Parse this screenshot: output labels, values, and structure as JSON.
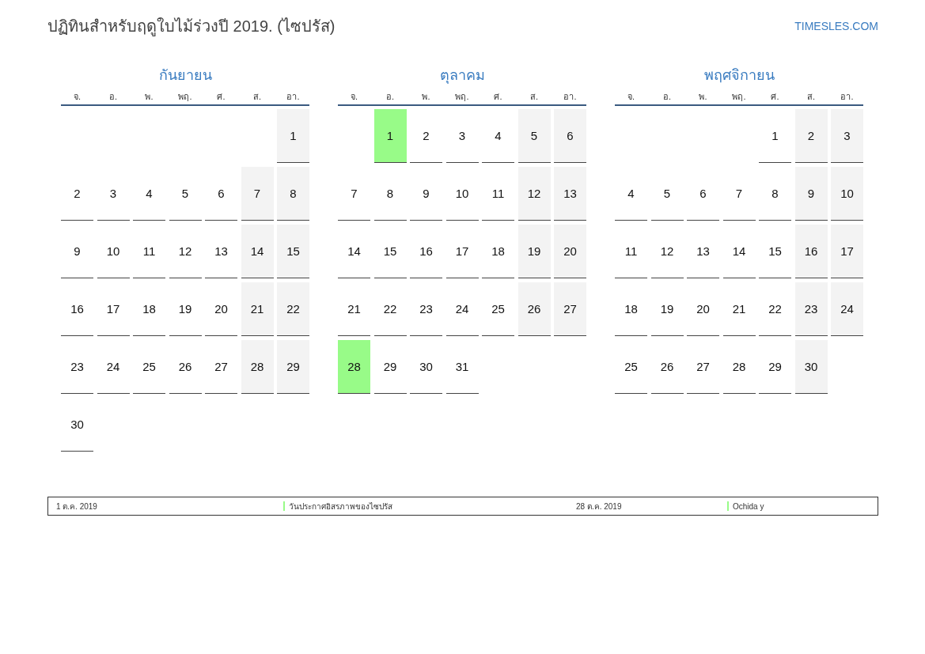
{
  "title": "ปฏิทินสำหรับฤดูใบไม้ร่วงปี 2019. (ไซปรัส)",
  "site": "TIMESLES.COM",
  "months": [
    {
      "name": "กันยายน",
      "weekdays": [
        "จ.",
        "อ.",
        "พ.",
        "พฤ.",
        "ศ.",
        "ส.",
        "อา."
      ],
      "weeks": [
        [
          {
            "kind": "empty"
          },
          {
            "kind": "empty"
          },
          {
            "kind": "empty"
          },
          {
            "kind": "empty"
          },
          {
            "kind": "empty"
          },
          {
            "kind": "empty"
          },
          {
            "kind": "day",
            "day": "1",
            "weekend": true,
            "holiday": false
          }
        ],
        [
          {
            "kind": "day",
            "day": "2",
            "weekend": false,
            "holiday": false
          },
          {
            "kind": "day",
            "day": "3",
            "weekend": false,
            "holiday": false
          },
          {
            "kind": "day",
            "day": "4",
            "weekend": false,
            "holiday": false
          },
          {
            "kind": "day",
            "day": "5",
            "weekend": false,
            "holiday": false
          },
          {
            "kind": "day",
            "day": "6",
            "weekend": false,
            "holiday": false
          },
          {
            "kind": "day",
            "day": "7",
            "weekend": true,
            "holiday": false
          },
          {
            "kind": "day",
            "day": "8",
            "weekend": true,
            "holiday": false
          }
        ],
        [
          {
            "kind": "day",
            "day": "9",
            "weekend": false,
            "holiday": false
          },
          {
            "kind": "day",
            "day": "10",
            "weekend": false,
            "holiday": false
          },
          {
            "kind": "day",
            "day": "11",
            "weekend": false,
            "holiday": false
          },
          {
            "kind": "day",
            "day": "12",
            "weekend": false,
            "holiday": false
          },
          {
            "kind": "day",
            "day": "13",
            "weekend": false,
            "holiday": false
          },
          {
            "kind": "day",
            "day": "14",
            "weekend": true,
            "holiday": false
          },
          {
            "kind": "day",
            "day": "15",
            "weekend": true,
            "holiday": false
          }
        ],
        [
          {
            "kind": "day",
            "day": "16",
            "weekend": false,
            "holiday": false
          },
          {
            "kind": "day",
            "day": "17",
            "weekend": false,
            "holiday": false
          },
          {
            "kind": "day",
            "day": "18",
            "weekend": false,
            "holiday": false
          },
          {
            "kind": "day",
            "day": "19",
            "weekend": false,
            "holiday": false
          },
          {
            "kind": "day",
            "day": "20",
            "weekend": false,
            "holiday": false
          },
          {
            "kind": "day",
            "day": "21",
            "weekend": true,
            "holiday": false
          },
          {
            "kind": "day",
            "day": "22",
            "weekend": true,
            "holiday": false
          }
        ],
        [
          {
            "kind": "day",
            "day": "23",
            "weekend": false,
            "holiday": false
          },
          {
            "kind": "day",
            "day": "24",
            "weekend": false,
            "holiday": false
          },
          {
            "kind": "day",
            "day": "25",
            "weekend": false,
            "holiday": false
          },
          {
            "kind": "day",
            "day": "26",
            "weekend": false,
            "holiday": false
          },
          {
            "kind": "day",
            "day": "27",
            "weekend": false,
            "holiday": false
          },
          {
            "kind": "day",
            "day": "28",
            "weekend": true,
            "holiday": false
          },
          {
            "kind": "day",
            "day": "29",
            "weekend": true,
            "holiday": false
          }
        ],
        [
          {
            "kind": "day",
            "day": "30",
            "weekend": false,
            "holiday": false
          }
        ]
      ]
    },
    {
      "name": "ตุลาคม",
      "weekdays": [
        "จ.",
        "อ.",
        "พ.",
        "พฤ.",
        "ศ.",
        "ส.",
        "อา."
      ],
      "weeks": [
        [
          {
            "kind": "empty"
          },
          {
            "kind": "day",
            "day": "1",
            "weekend": false,
            "holiday": true
          },
          {
            "kind": "day",
            "day": "2",
            "weekend": false,
            "holiday": false
          },
          {
            "kind": "day",
            "day": "3",
            "weekend": false,
            "holiday": false
          },
          {
            "kind": "day",
            "day": "4",
            "weekend": false,
            "holiday": false
          },
          {
            "kind": "day",
            "day": "5",
            "weekend": true,
            "holiday": false
          },
          {
            "kind": "day",
            "day": "6",
            "weekend": true,
            "holiday": false
          }
        ],
        [
          {
            "kind": "day",
            "day": "7",
            "weekend": false,
            "holiday": false
          },
          {
            "kind": "day",
            "day": "8",
            "weekend": false,
            "holiday": false
          },
          {
            "kind": "day",
            "day": "9",
            "weekend": false,
            "holiday": false
          },
          {
            "kind": "day",
            "day": "10",
            "weekend": false,
            "holiday": false
          },
          {
            "kind": "day",
            "day": "11",
            "weekend": false,
            "holiday": false
          },
          {
            "kind": "day",
            "day": "12",
            "weekend": true,
            "holiday": false
          },
          {
            "kind": "day",
            "day": "13",
            "weekend": true,
            "holiday": false
          }
        ],
        [
          {
            "kind": "day",
            "day": "14",
            "weekend": false,
            "holiday": false
          },
          {
            "kind": "day",
            "day": "15",
            "weekend": false,
            "holiday": false
          },
          {
            "kind": "day",
            "day": "16",
            "weekend": false,
            "holiday": false
          },
          {
            "kind": "day",
            "day": "17",
            "weekend": false,
            "holiday": false
          },
          {
            "kind": "day",
            "day": "18",
            "weekend": false,
            "holiday": false
          },
          {
            "kind": "day",
            "day": "19",
            "weekend": true,
            "holiday": false
          },
          {
            "kind": "day",
            "day": "20",
            "weekend": true,
            "holiday": false
          }
        ],
        [
          {
            "kind": "day",
            "day": "21",
            "weekend": false,
            "holiday": false
          },
          {
            "kind": "day",
            "day": "22",
            "weekend": false,
            "holiday": false
          },
          {
            "kind": "day",
            "day": "23",
            "weekend": false,
            "holiday": false
          },
          {
            "kind": "day",
            "day": "24",
            "weekend": false,
            "holiday": false
          },
          {
            "kind": "day",
            "day": "25",
            "weekend": false,
            "holiday": false
          },
          {
            "kind": "day",
            "day": "26",
            "weekend": true,
            "holiday": false
          },
          {
            "kind": "day",
            "day": "27",
            "weekend": true,
            "holiday": false
          }
        ],
        [
          {
            "kind": "day",
            "day": "28",
            "weekend": false,
            "holiday": true
          },
          {
            "kind": "day",
            "day": "29",
            "weekend": false,
            "holiday": false
          },
          {
            "kind": "day",
            "day": "30",
            "weekend": false,
            "holiday": false
          },
          {
            "kind": "day",
            "day": "31",
            "weekend": false,
            "holiday": false
          }
        ]
      ]
    },
    {
      "name": "พฤศจิกายน",
      "weekdays": [
        "จ.",
        "อ.",
        "พ.",
        "พฤ.",
        "ศ.",
        "ส.",
        "อา."
      ],
      "weeks": [
        [
          {
            "kind": "empty"
          },
          {
            "kind": "empty"
          },
          {
            "kind": "empty"
          },
          {
            "kind": "empty"
          },
          {
            "kind": "day",
            "day": "1",
            "weekend": false,
            "holiday": false
          },
          {
            "kind": "day",
            "day": "2",
            "weekend": true,
            "holiday": false
          },
          {
            "kind": "day",
            "day": "3",
            "weekend": true,
            "holiday": false
          }
        ],
        [
          {
            "kind": "day",
            "day": "4",
            "weekend": false,
            "holiday": false
          },
          {
            "kind": "day",
            "day": "5",
            "weekend": false,
            "holiday": false
          },
          {
            "kind": "day",
            "day": "6",
            "weekend": false,
            "holiday": false
          },
          {
            "kind": "day",
            "day": "7",
            "weekend": false,
            "holiday": false
          },
          {
            "kind": "day",
            "day": "8",
            "weekend": false,
            "holiday": false
          },
          {
            "kind": "day",
            "day": "9",
            "weekend": true,
            "holiday": false
          },
          {
            "kind": "day",
            "day": "10",
            "weekend": true,
            "holiday": false
          }
        ],
        [
          {
            "kind": "day",
            "day": "11",
            "weekend": false,
            "holiday": false
          },
          {
            "kind": "day",
            "day": "12",
            "weekend": false,
            "holiday": false
          },
          {
            "kind": "day",
            "day": "13",
            "weekend": false,
            "holiday": false
          },
          {
            "kind": "day",
            "day": "14",
            "weekend": false,
            "holiday": false
          },
          {
            "kind": "day",
            "day": "15",
            "weekend": false,
            "holiday": false
          },
          {
            "kind": "day",
            "day": "16",
            "weekend": true,
            "holiday": false
          },
          {
            "kind": "day",
            "day": "17",
            "weekend": true,
            "holiday": false
          }
        ],
        [
          {
            "kind": "day",
            "day": "18",
            "weekend": false,
            "holiday": false
          },
          {
            "kind": "day",
            "day": "19",
            "weekend": false,
            "holiday": false
          },
          {
            "kind": "day",
            "day": "20",
            "weekend": false,
            "holiday": false
          },
          {
            "kind": "day",
            "day": "21",
            "weekend": false,
            "holiday": false
          },
          {
            "kind": "day",
            "day": "22",
            "weekend": false,
            "holiday": false
          },
          {
            "kind": "day",
            "day": "23",
            "weekend": true,
            "holiday": false
          },
          {
            "kind": "day",
            "day": "24",
            "weekend": true,
            "holiday": false
          }
        ],
        [
          {
            "kind": "day",
            "day": "25",
            "weekend": false,
            "holiday": false
          },
          {
            "kind": "day",
            "day": "26",
            "weekend": false,
            "holiday": false
          },
          {
            "kind": "day",
            "day": "27",
            "weekend": false,
            "holiday": false
          },
          {
            "kind": "day",
            "day": "28",
            "weekend": false,
            "holiday": false
          },
          {
            "kind": "day",
            "day": "29",
            "weekend": false,
            "holiday": false
          },
          {
            "kind": "day",
            "day": "30",
            "weekend": true,
            "holiday": false
          }
        ]
      ]
    }
  ],
  "legend": [
    {
      "date": "1 ต.ค. 2019",
      "name": "วันประกาศอิสรภาพของไซปรัส",
      "color": "#98fb88"
    },
    {
      "date": "28 ต.ค. 2019",
      "name": "Ochida y",
      "color": "#98fb88"
    }
  ]
}
